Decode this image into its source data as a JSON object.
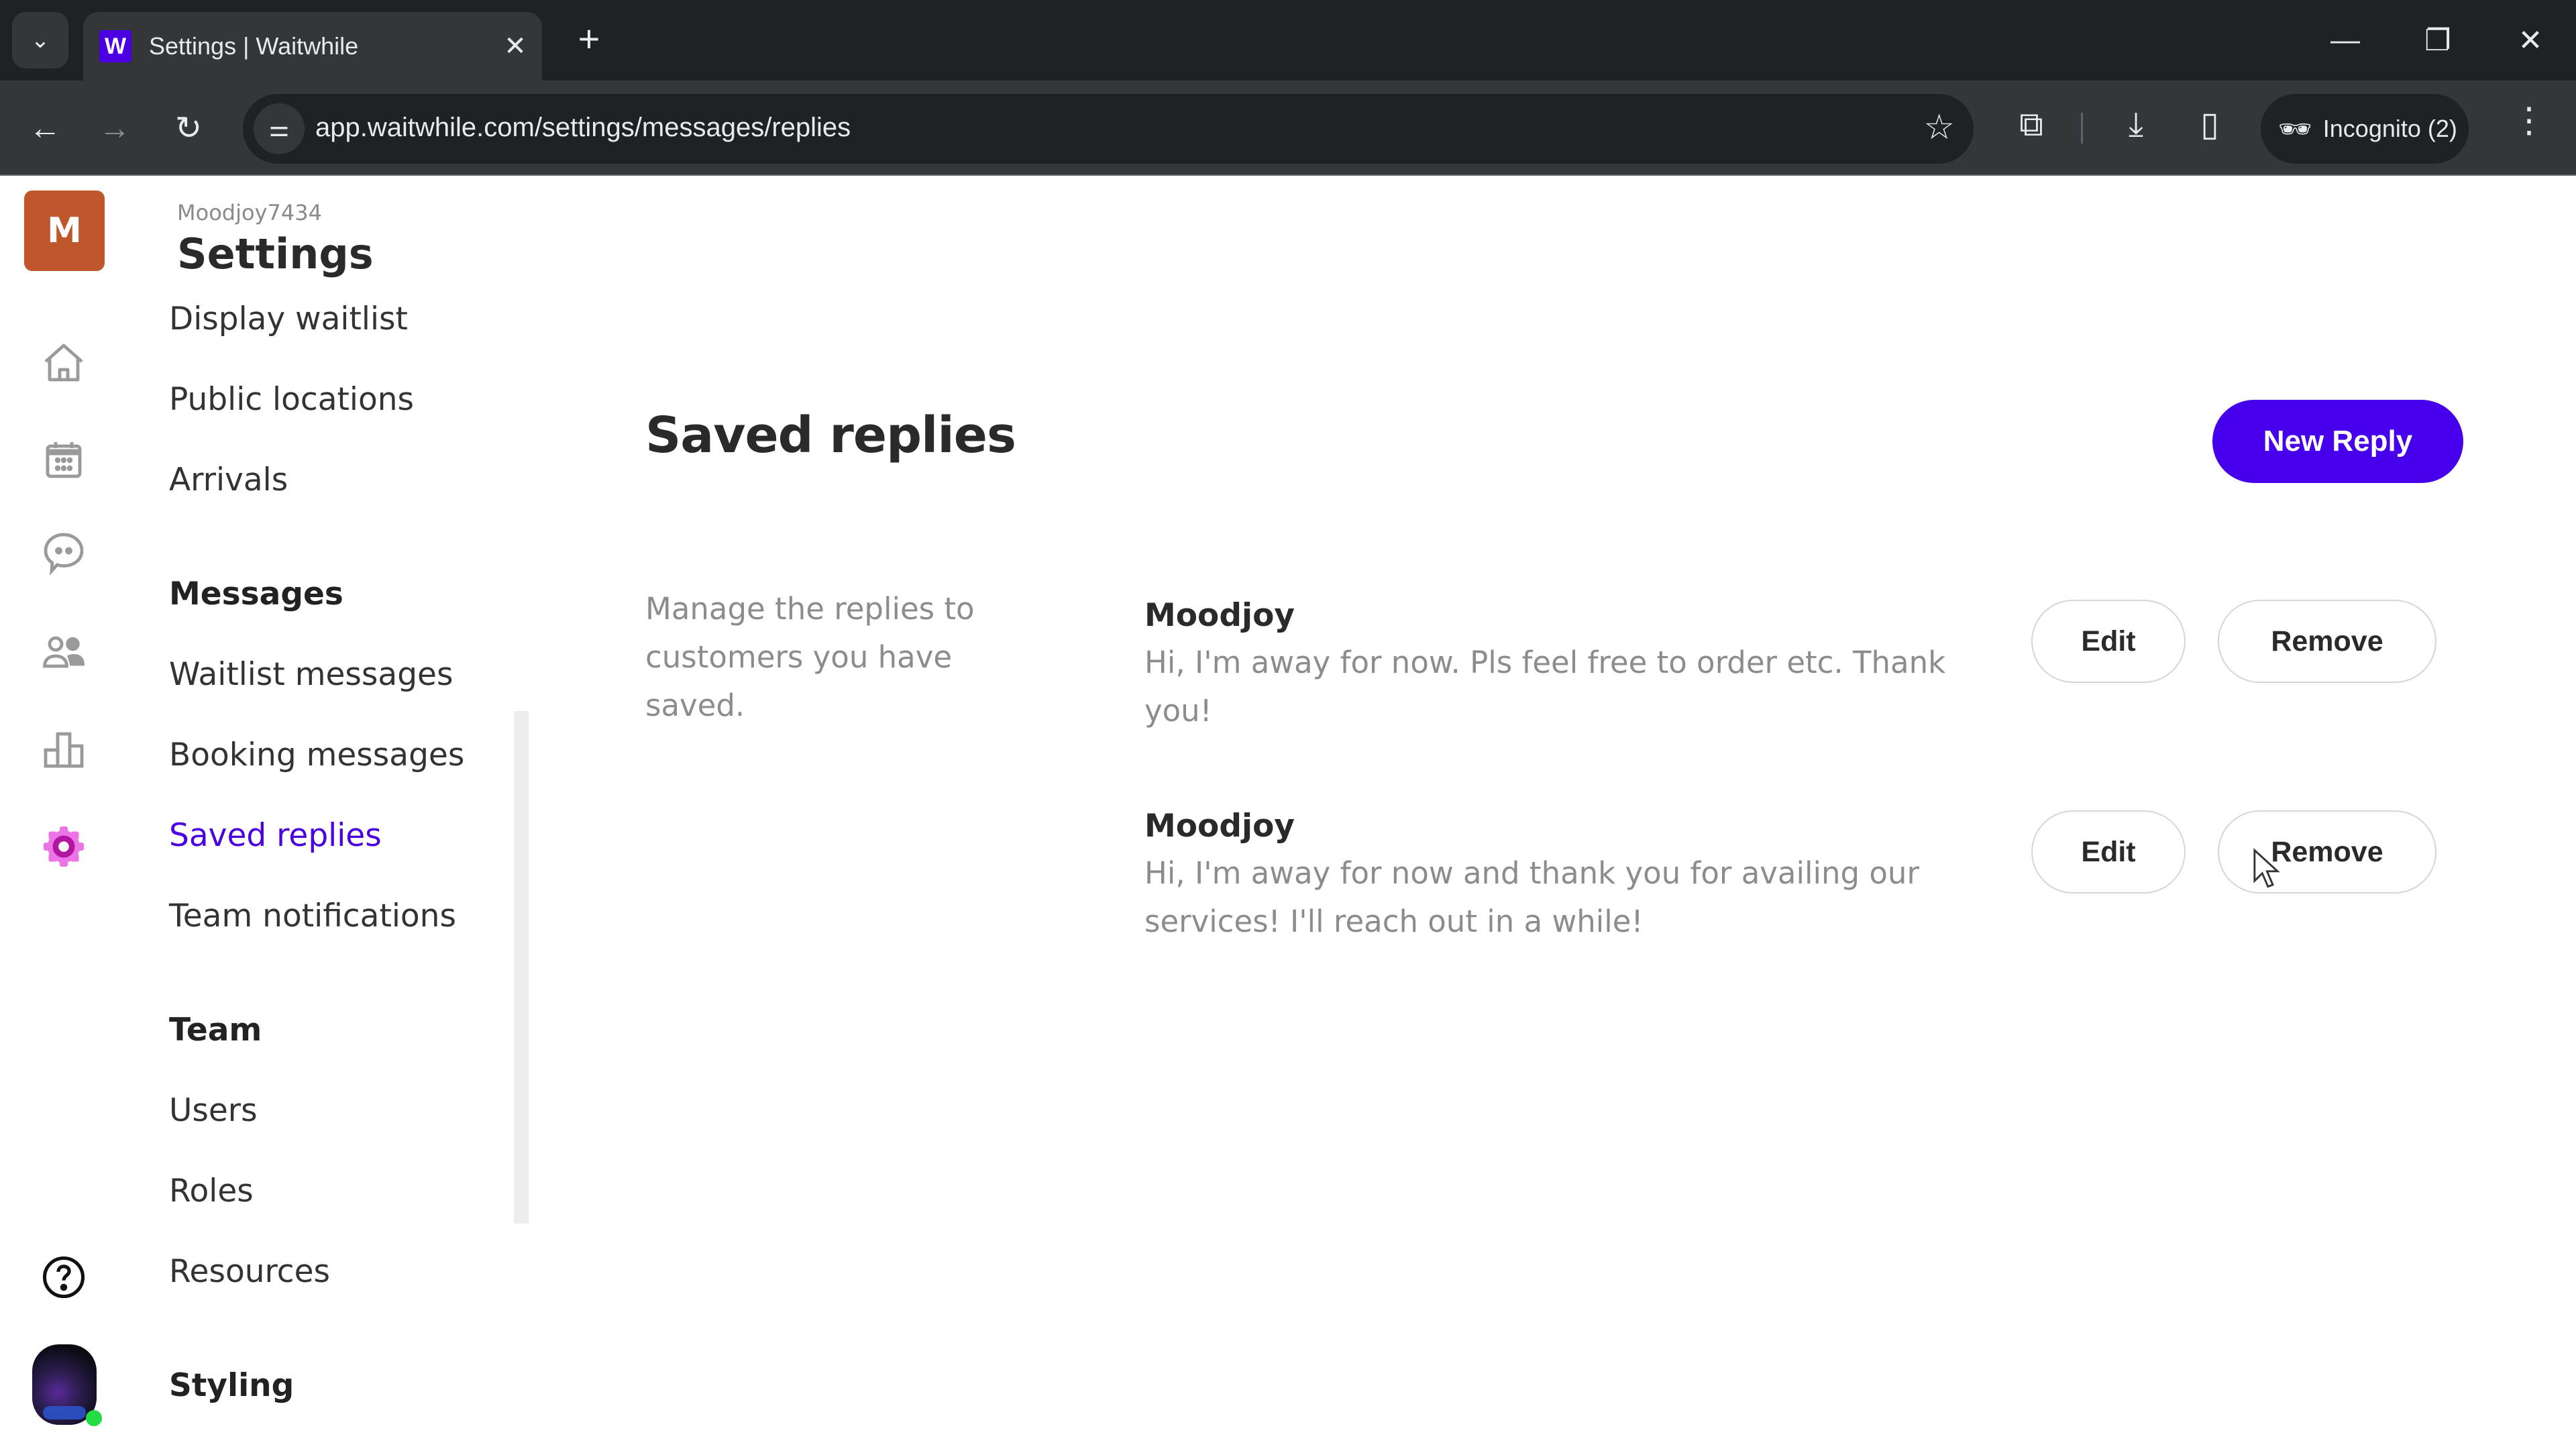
{
  "browser": {
    "tab_title": "Settings | Waitwhile",
    "favicon_letter": "W",
    "url": "app.waitwhile.com/settings/messages/replies",
    "profile_label": "Incognito (2)",
    "icons": {
      "tab_search": "chevron-down-icon",
      "close_tab": "close-icon",
      "new_tab": "plus-icon",
      "back": "arrow-left-icon",
      "forward": "arrow-right-icon",
      "reload": "reload-icon",
      "site_info": "tune-icon",
      "bookmark": "star-icon",
      "extensions": "puzzle-icon",
      "downloads": "download-icon",
      "side_panel": "side-panel-icon",
      "incognito": "incognito-icon",
      "menu": "kebab-menu-icon",
      "minimize": "minimize-icon",
      "restore": "restore-icon",
      "close_window": "close-icon"
    },
    "glyphs": {
      "tab_search": "⌄",
      "close": "✕",
      "plus": "+",
      "back": "←",
      "forward": "→",
      "reload": "↻",
      "site_info": "⚌",
      "star": "☆",
      "extensions": "⧉",
      "download": "⤓",
      "side_panel": "▯",
      "incognito": "🕶",
      "kebab": "⋮",
      "minimize": "—",
      "restore": "❐"
    }
  },
  "rail": {
    "org_initial": "M",
    "items": [
      {
        "name": "home",
        "icon": "home-icon"
      },
      {
        "name": "calendar",
        "icon": "calendar-icon"
      },
      {
        "name": "messages",
        "icon": "chat-icon"
      },
      {
        "name": "customers",
        "icon": "users-icon"
      },
      {
        "name": "analytics",
        "icon": "bar-chart-icon"
      },
      {
        "name": "settings",
        "icon": "gear-icon",
        "active": true
      }
    ],
    "help_icon": "help-icon",
    "active_color": "#d633c8"
  },
  "settings_nav": {
    "org_name": "Moodjoy7434",
    "title": "Settings",
    "items_top": [
      "Display waitlist",
      "Public locations",
      "Arrivals"
    ],
    "messages_section": "Messages",
    "messages_items": [
      "Waitlist messages",
      "Booking messages",
      "Saved replies",
      "Team notifications"
    ],
    "active_item": "Saved replies",
    "team_section": "Team",
    "team_items": [
      "Users",
      "Roles",
      "Resources"
    ],
    "styling_section": "Styling"
  },
  "main": {
    "title": "Saved replies",
    "new_reply_label": "New Reply",
    "description": "Manage the replies to customers you have saved.",
    "replies": [
      {
        "name": "Moodjoy",
        "text": "Hi, I'm away for now. Pls feel free to order etc. Thank you!",
        "edit_label": "Edit",
        "remove_label": "Remove"
      },
      {
        "name": "Moodjoy",
        "text": "Hi, I'm away for now and thank you for availing our services! I'll reach out in a while!",
        "edit_label": "Edit",
        "remove_label": "Remove"
      }
    ]
  },
  "colors": {
    "brand": "#4600ec",
    "org_logo": "#c0562c",
    "active_nav": "#4a00e0"
  }
}
